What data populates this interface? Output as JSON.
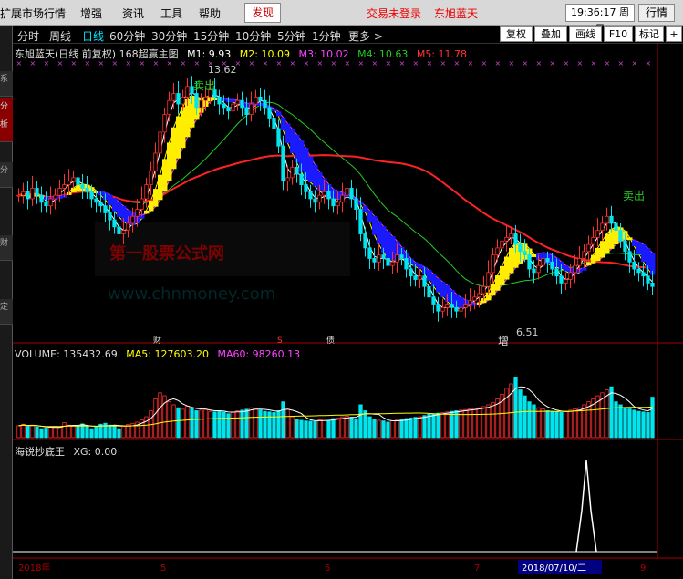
{
  "menu": {
    "items": [
      "扩展市场行情",
      "增强",
      "资讯",
      "工具",
      "帮助"
    ],
    "discover": "发现",
    "login_status": "交易未登录",
    "account_name": "东旭蓝天",
    "clock_time": "19:36:17",
    "clock_day": "周日",
    "quotes_button": "行情"
  },
  "left_rail": {
    "labels": [
      "系",
      "分",
      "析",
      "分",
      "财",
      "定"
    ]
  },
  "period_bar": {
    "periods": [
      "分时",
      "周线",
      "日线",
      "60分钟",
      "30分钟",
      "15分钟",
      "10分钟",
      "5分钟",
      "1分钟",
      "更多 >"
    ],
    "selected": "日线",
    "tools": [
      "复权",
      "叠加",
      "画线",
      "F10",
      "标记",
      "+"
    ]
  },
  "main_chart": {
    "title": "东旭蓝天(日线 前复权) 168超赢主图",
    "ma": [
      {
        "label": "M1: 9.93",
        "color": "#ffffff"
      },
      {
        "label": "M2: 10.09",
        "color": "#ffff00"
      },
      {
        "label": "M3: 10.02",
        "color": "#ff44ff"
      },
      {
        "label": "M4: 10.63",
        "color": "#22cc22"
      },
      {
        "label": "M5: 11.78",
        "color": "#ff3333"
      }
    ],
    "high_label": "13.62",
    "low_label": "6.51",
    "sell_label_1": "卖出",
    "sell_label_2": "卖出",
    "add_label": "增",
    "watermark_1": "第一股票公式网",
    "watermark_2": "www.chnmoney.com",
    "event_labels": [
      "财",
      "S",
      "债"
    ]
  },
  "volume_panel": {
    "title": "VOLUME: 135432.69",
    "ma5": "MA5: 127603.20",
    "ma60": "MA60: 98260.13"
  },
  "indicator_panel": {
    "title": "海锐抄底王",
    "xg": "XG: 0.00"
  },
  "date_axis": {
    "start": "2018年",
    "ticks": [
      "5",
      "6",
      "7",
      "9"
    ],
    "cursor_date": "2018/07/10/二"
  },
  "chart_data": [
    {
      "type": "candlestick",
      "title": "东旭蓝天(日线 前复权) 168超赢主图",
      "ylim": [
        6.0,
        14.0
      ],
      "x": [
        1,
        2,
        3,
        4,
        5,
        6,
        7,
        8,
        9,
        10,
        11,
        12,
        13,
        14,
        15,
        16,
        17,
        18,
        19,
        20,
        21,
        22,
        23,
        24,
        25,
        26,
        27,
        28,
        29,
        30,
        31,
        32,
        33,
        34,
        35,
        36,
        37,
        38,
        39,
        40,
        41,
        42,
        43,
        44,
        45,
        46,
        47,
        48,
        49,
        50,
        51,
        52,
        53,
        54,
        55,
        56,
        57,
        58,
        59,
        60,
        61,
        62,
        63,
        64,
        65,
        66,
        67,
        68,
        69,
        70,
        71,
        72,
        73,
        74,
        75,
        76,
        77,
        78,
        79,
        80,
        81,
        82,
        83,
        84,
        85,
        86,
        87,
        88,
        89,
        90,
        91,
        92,
        93,
        94,
        95,
        96,
        97,
        98,
        99,
        100,
        101,
        102,
        103,
        104,
        105,
        106,
        107,
        108,
        109,
        110,
        111,
        112,
        113,
        114,
        115,
        116,
        117,
        118,
        119,
        120,
        121,
        122,
        123,
        124,
        125,
        126,
        127,
        128,
        129,
        130,
        131,
        132,
        133,
        134,
        135,
        136,
        137,
        138,
        139,
        140
      ],
      "close": [
        10.1,
        10.2,
        10.0,
        10.3,
        10.1,
        9.9,
        9.8,
        10.0,
        10.1,
        10.3,
        10.4,
        10.5,
        10.6,
        10.4,
        10.3,
        10.2,
        10.0,
        9.9,
        9.8,
        9.6,
        9.4,
        9.2,
        9.0,
        9.1,
        9.3,
        9.5,
        9.7,
        10.0,
        10.4,
        10.8,
        11.3,
        11.9,
        12.4,
        12.8,
        13.0,
        12.7,
        12.9,
        13.2,
        13.0,
        12.6,
        12.8,
        12.9,
        13.1,
        12.9,
        12.7,
        12.6,
        12.5,
        12.7,
        12.8,
        12.6,
        12.4,
        12.7,
        12.9,
        12.8,
        12.6,
        12.3,
        12.0,
        11.5,
        10.5,
        10.6,
        10.9,
        10.7,
        10.4,
        10.2,
        10.0,
        9.9,
        10.1,
        10.2,
        10.0,
        9.8,
        9.9,
        10.1,
        10.3,
        10.0,
        9.7,
        9.0,
        8.6,
        8.3,
        8.2,
        8.4,
        8.3,
        8.1,
        8.2,
        8.4,
        8.3,
        8.0,
        7.8,
        7.7,
        7.8,
        7.5,
        7.2,
        7.0,
        6.8,
        6.9,
        7.0,
        6.9,
        6.8,
        6.9,
        7.0,
        7.1,
        7.2,
        7.3,
        7.5,
        7.9,
        8.4,
        8.6,
        8.8,
        8.9,
        9.0,
        8.7,
        8.5,
        8.4,
        8.0,
        7.9,
        8.1,
        8.3,
        8.2,
        8.0,
        7.8,
        7.6,
        7.7,
        7.9,
        8.1,
        8.3,
        8.5,
        8.7,
        8.9,
        9.1,
        9.3,
        9.5,
        9.3,
        9.1,
        8.8,
        8.5,
        8.2,
        8.0,
        7.9,
        7.8,
        7.6,
        7.5
      ],
      "highlights": {
        "high": 13.62,
        "low": 6.51
      }
    },
    {
      "type": "bar",
      "title": "VOLUME: 135432.69",
      "ylim": [
        0,
        250000
      ],
      "values": [
        40000,
        45000,
        38000,
        42000,
        36000,
        30000,
        32000,
        35000,
        38000,
        36000,
        50000,
        42000,
        40000,
        38000,
        46000,
        40000,
        30000,
        36000,
        45000,
        48000,
        42000,
        40000,
        30000,
        38000,
        44000,
        48000,
        52000,
        60000,
        70000,
        90000,
        130000,
        150000,
        140000,
        120000,
        110000,
        100000,
        95000,
        105000,
        98000,
        90000,
        92000,
        94000,
        88000,
        86000,
        90000,
        85000,
        80000,
        86000,
        90000,
        92000,
        95000,
        100000,
        98000,
        92000,
        88000,
        86000,
        84000,
        90000,
        120000,
        95000,
        70000,
        60000,
        58000,
        56000,
        55000,
        54000,
        60000,
        62000,
        58000,
        64000,
        66000,
        70000,
        72000,
        68000,
        62000,
        110000,
        90000,
        70000,
        60000,
        58000,
        56000,
        52000,
        56000,
        60000,
        62000,
        64000,
        66000,
        68000,
        70000,
        74000,
        78000,
        80000,
        82000,
        84000,
        86000,
        88000,
        90000,
        92000,
        94000,
        96000,
        98000,
        100000,
        104000,
        110000,
        118000,
        130000,
        145000,
        165000,
        180000,
        200000,
        160000,
        140000,
        120000,
        110000,
        100000,
        96000,
        90000,
        88000,
        86000,
        84000,
        88000,
        92000,
        96000,
        100000,
        110000,
        120000,
        130000,
        140000,
        150000,
        160000,
        170000,
        120000,
        110000,
        100000,
        96000,
        92000,
        88000,
        86000,
        84000,
        135432
      ]
    }
  ]
}
